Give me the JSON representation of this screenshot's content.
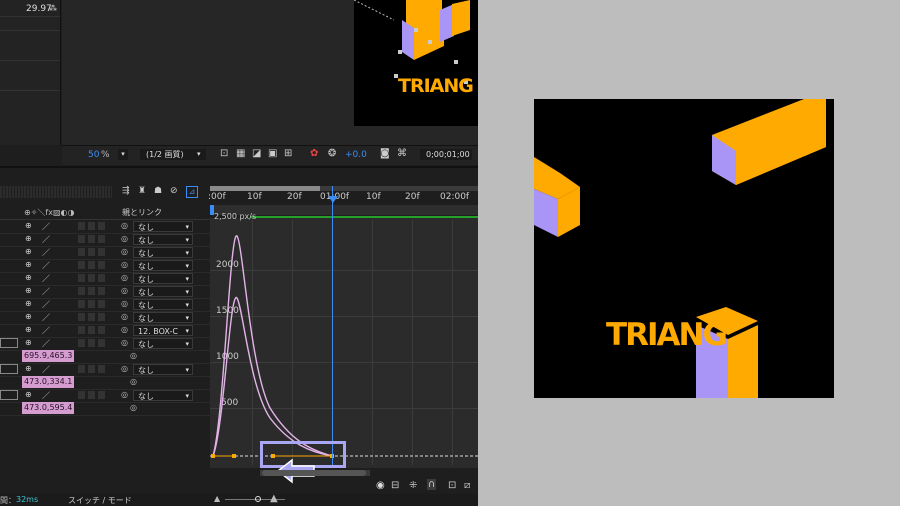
{
  "top": {
    "fps": "29.97"
  },
  "viewer": {
    "zoom": "50",
    "zoom_unit": "%",
    "resolution": "(1/2 画質)",
    "exposure": "+0.0",
    "timecode": "0;00;01;00",
    "comp_text": "TRIANG"
  },
  "timeline": {
    "columns_label": "親とリンク",
    "ruler": [
      ":00f",
      "10f",
      "20f",
      "01:00f",
      "10f",
      "20f",
      "02:00f"
    ],
    "graph_top_label": "2,500 px/s",
    "y_labels": [
      "2000",
      "1500",
      "1000",
      "500"
    ],
    "status_time": "32ms",
    "status_label_prefix": "間：",
    "switch_mode": "スイッチ / モード",
    "layers": [
      {
        "parent": "なし"
      },
      {
        "parent": "なし"
      },
      {
        "parent": "なし"
      },
      {
        "parent": "なし"
      },
      {
        "parent": "なし"
      },
      {
        "parent": "なし"
      },
      {
        "parent": "なし"
      },
      {
        "parent": "なし"
      },
      {
        "parent": "12. BOX-C"
      },
      {
        "parent": "なし"
      }
    ],
    "props": [
      {
        "value": "695.9,465.3",
        "parent": ""
      },
      {
        "value": "",
        "parent": "なし"
      },
      {
        "value": "473.0,334.1",
        "parent": ""
      },
      {
        "value": "",
        "parent": "なし"
      },
      {
        "value": "473.0,595.4",
        "parent": ""
      }
    ]
  },
  "preview": {
    "text": "TRIANG",
    "colors": {
      "orange": "#ffaa00",
      "lavender": "#a895f5",
      "bg": "#000000"
    }
  },
  "colors": {
    "accent_blue": "#3a8df5",
    "highlight": "#a9a6f3",
    "curve": "#e3b3e8",
    "value_bg": "#d59cd0"
  }
}
